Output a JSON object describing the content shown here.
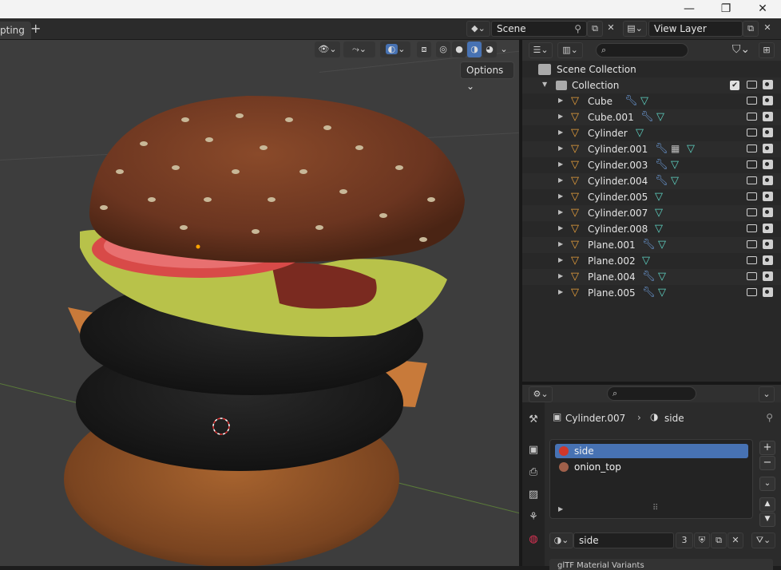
{
  "window": {
    "minimize": "—",
    "restore": "❐",
    "close": "✕"
  },
  "topbar": {
    "workspace_tab": "pting",
    "add_tab": "+",
    "scene_name": "Scene",
    "view_layer_name": "View Layer"
  },
  "viewport": {
    "options_label": "Options ⌄"
  },
  "outliner": {
    "root": "Scene Collection",
    "collection": "Collection",
    "objects": [
      {
        "name": "Cube",
        "modifier": true,
        "mesh": true
      },
      {
        "name": "Cube.001",
        "modifier": true,
        "mesh": true
      },
      {
        "name": "Cylinder",
        "modifier": false,
        "mesh": true
      },
      {
        "name": "Cylinder.001",
        "modifier": true,
        "mesh": true
      },
      {
        "name": "Cylinder.003",
        "modifier": true,
        "mesh": true
      },
      {
        "name": "Cylinder.004",
        "modifier": true,
        "mesh": true
      },
      {
        "name": "Cylinder.005",
        "modifier": false,
        "mesh": true
      },
      {
        "name": "Cylinder.007",
        "modifier": false,
        "mesh": true
      },
      {
        "name": "Cylinder.008",
        "modifier": false,
        "mesh": true
      },
      {
        "name": "Plane.001",
        "modifier": true,
        "mesh": true
      },
      {
        "name": "Plane.002",
        "modifier": false,
        "mesh": true
      },
      {
        "name": "Plane.004",
        "modifier": true,
        "mesh": true
      },
      {
        "name": "Plane.005",
        "modifier": true,
        "mesh": true
      }
    ]
  },
  "properties": {
    "breadcrumb_object": "Cylinder.007",
    "breadcrumb_material": "side",
    "material_slots": [
      {
        "name": "side",
        "color": "#d0372a"
      },
      {
        "name": "onion_top",
        "color": "#a0604a"
      }
    ],
    "material_name": "side",
    "user_count": "3",
    "next_panel": "glTF Material Variants"
  },
  "colors": {
    "accent": "#4772b3",
    "mesh_icon": "#5fd4c4",
    "modifier_icon": "#6c9bd8",
    "object_icon": "#e8a03c"
  }
}
